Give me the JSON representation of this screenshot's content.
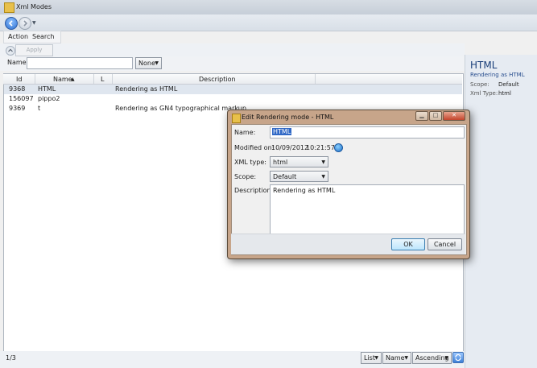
{
  "window": {
    "title": "Xml Modes"
  },
  "menu": {
    "action": "Action",
    "search": "Search"
  },
  "toolbar": {
    "apply_search": "Apply Search"
  },
  "filter": {
    "name_label": "Name:",
    "name_value": "",
    "mode_value": "None"
  },
  "grid": {
    "columns": {
      "id": "Id",
      "name": "Name",
      "l": "L",
      "description": "Description"
    },
    "rows": [
      {
        "id": "9368",
        "name": "HTML",
        "l": "",
        "description": "Rendering as HTML"
      },
      {
        "id": "156097",
        "name": "pippo2",
        "l": "",
        "description": ""
      },
      {
        "id": "9369",
        "name": "t",
        "l": "",
        "description": "Rendering as GN4 typographical markup"
      }
    ]
  },
  "status": {
    "count": "1/3",
    "view": "List",
    "sort_field": "Name",
    "sort_order": "Ascending"
  },
  "detail": {
    "title": "HTML",
    "subtitle": "Rendering as HTML",
    "scope_label": "Scope:",
    "scope_value": "Default",
    "xmltype_label": "Xml Type:",
    "xmltype_value": "html"
  },
  "dialog": {
    "title": "Edit Rendering mode - HTML",
    "name_label": "Name:",
    "name_value": "HTML",
    "modified_label": "Modified on:",
    "modified_date": "10/09/2012",
    "modified_time": "10:21:57",
    "xmltype_label": "XML type:",
    "xmltype_value": "html",
    "scope_label": "Scope:",
    "scope_value": "Default",
    "description_label": "Description:",
    "description_value": "Rendering as HTML",
    "ok": "OK",
    "cancel": "Cancel"
  },
  "colors": {
    "accent": "#2c6fd1",
    "dialog_frame": "#c7a58a",
    "selection": "#3169c6"
  }
}
